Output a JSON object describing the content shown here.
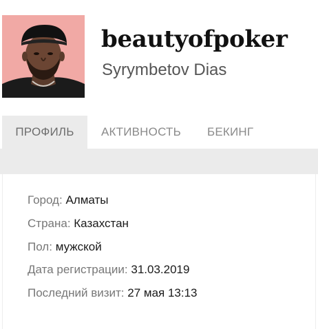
{
  "profile": {
    "username": "beautyofpoker",
    "real_name": "Syrymbetov Dias"
  },
  "tabs": [
    {
      "label": "ПРОФИЛЬ",
      "active": true
    },
    {
      "label": "АКТИВНОСТЬ",
      "active": false
    },
    {
      "label": "БЕКИНГ",
      "active": false
    }
  ],
  "info": {
    "city_label": "Город:",
    "city_value": "Алматы",
    "country_label": "Страна:",
    "country_value": "Казахстан",
    "gender_label": "Пол:",
    "gender_value": "мужской",
    "registered_label": "Дата регистрации:",
    "registered_value": "31.03.2019",
    "last_visit_label": "Последний визит:",
    "last_visit_value": "27 мая 13:13"
  },
  "colors": {
    "tab_active_bg": "#ebebeb",
    "avatar_bg": "#f1a9a5"
  }
}
